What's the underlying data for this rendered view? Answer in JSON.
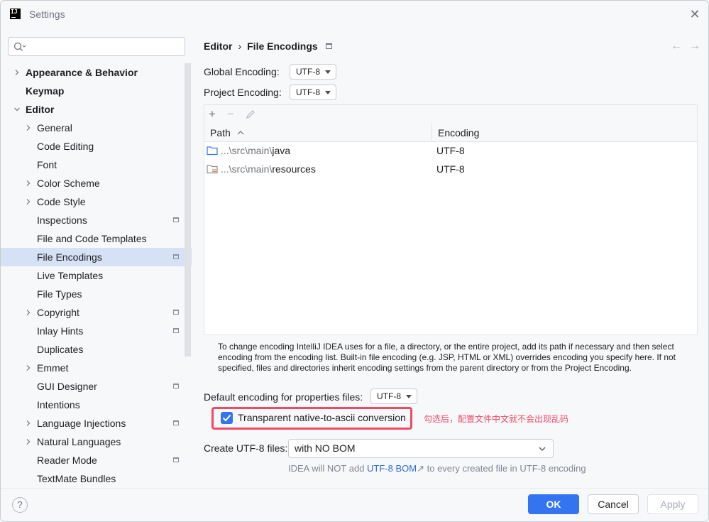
{
  "window": {
    "title": "Settings",
    "app_icon_text": "IJ"
  },
  "search": {
    "placeholder": ""
  },
  "sidebar": {
    "items": [
      {
        "label": "Appearance & Behavior",
        "bold": true,
        "chevron": true,
        "indent": 0
      },
      {
        "label": "Keymap",
        "bold": true,
        "chevron": false,
        "indent": 0
      },
      {
        "label": "Editor",
        "bold": true,
        "chevron": "down",
        "indent": 0
      },
      {
        "label": "General",
        "chevron": true,
        "indent": 1
      },
      {
        "label": "Code Editing",
        "chevron": false,
        "indent": 1
      },
      {
        "label": "Font",
        "chevron": false,
        "indent": 1
      },
      {
        "label": "Color Scheme",
        "chevron": true,
        "indent": 1
      },
      {
        "label": "Code Style",
        "chevron": true,
        "indent": 1
      },
      {
        "label": "Inspections",
        "chevron": false,
        "indent": 1,
        "pin": true
      },
      {
        "label": "File and Code Templates",
        "chevron": false,
        "indent": 1
      },
      {
        "label": "File Encodings",
        "chevron": false,
        "indent": 1,
        "pin": true,
        "selected": true
      },
      {
        "label": "Live Templates",
        "chevron": false,
        "indent": 1
      },
      {
        "label": "File Types",
        "chevron": false,
        "indent": 1
      },
      {
        "label": "Copyright",
        "chevron": true,
        "indent": 1,
        "pin": true
      },
      {
        "label": "Inlay Hints",
        "chevron": false,
        "indent": 1,
        "pin": true
      },
      {
        "label": "Duplicates",
        "chevron": false,
        "indent": 1
      },
      {
        "label": "Emmet",
        "chevron": true,
        "indent": 1
      },
      {
        "label": "GUI Designer",
        "chevron": false,
        "indent": 1,
        "pin": true
      },
      {
        "label": "Intentions",
        "chevron": false,
        "indent": 1
      },
      {
        "label": "Language Injections",
        "chevron": true,
        "indent": 1,
        "pin": true
      },
      {
        "label": "Natural Languages",
        "chevron": true,
        "indent": 1
      },
      {
        "label": "Reader Mode",
        "chevron": false,
        "indent": 1,
        "pin": true
      },
      {
        "label": "TextMate Bundles",
        "chevron": false,
        "indent": 1
      }
    ]
  },
  "breadcrumb": {
    "parent": "Editor",
    "separator": "›",
    "current": "File Encodings"
  },
  "global_encoding": {
    "label": "Global Encoding:",
    "value": "UTF-8"
  },
  "project_encoding": {
    "label": "Project Encoding:",
    "value": "UTF-8"
  },
  "table": {
    "col_path": "Path",
    "col_encoding": "Encoding",
    "rows": [
      {
        "path_prefix": "...\\src\\main\\",
        "path_name": "java",
        "encoding": "UTF-8"
      },
      {
        "path_prefix": "...\\src\\main\\",
        "path_name": "resources",
        "encoding": "UTF-8"
      }
    ]
  },
  "description": "To change encoding IntelliJ IDEA uses for a file, a directory, or the entire project, add its path if necessary and then select encoding from the encoding list. Built-in file encoding (e.g. JSP, HTML or XML) overrides encoding you specify here. If not specified, files and directories inherit encoding settings from the parent directory or from the Project Encoding.",
  "properties_encoding": {
    "label": "Default encoding for properties files:",
    "value": "UTF-8"
  },
  "native_to_ascii": {
    "label": "Transparent native-to-ascii conversion",
    "checked": true
  },
  "annotation": "勾选后，配置文件中文就不会出现乱码",
  "create_utf8": {
    "label": "Create UTF-8 files:",
    "value": "with NO BOM"
  },
  "bom_note": {
    "before": "IDEA will NOT add ",
    "link": "UTF-8 BOM",
    "link_arrow": "↗",
    "after": " to every created file in UTF-8 encoding"
  },
  "buttons": {
    "ok": "OK",
    "cancel": "Cancel",
    "apply": "Apply",
    "help": "?"
  },
  "colors": {
    "accent": "#3574f0",
    "annotation": "#f24962",
    "selection": "#d5e1f5"
  }
}
